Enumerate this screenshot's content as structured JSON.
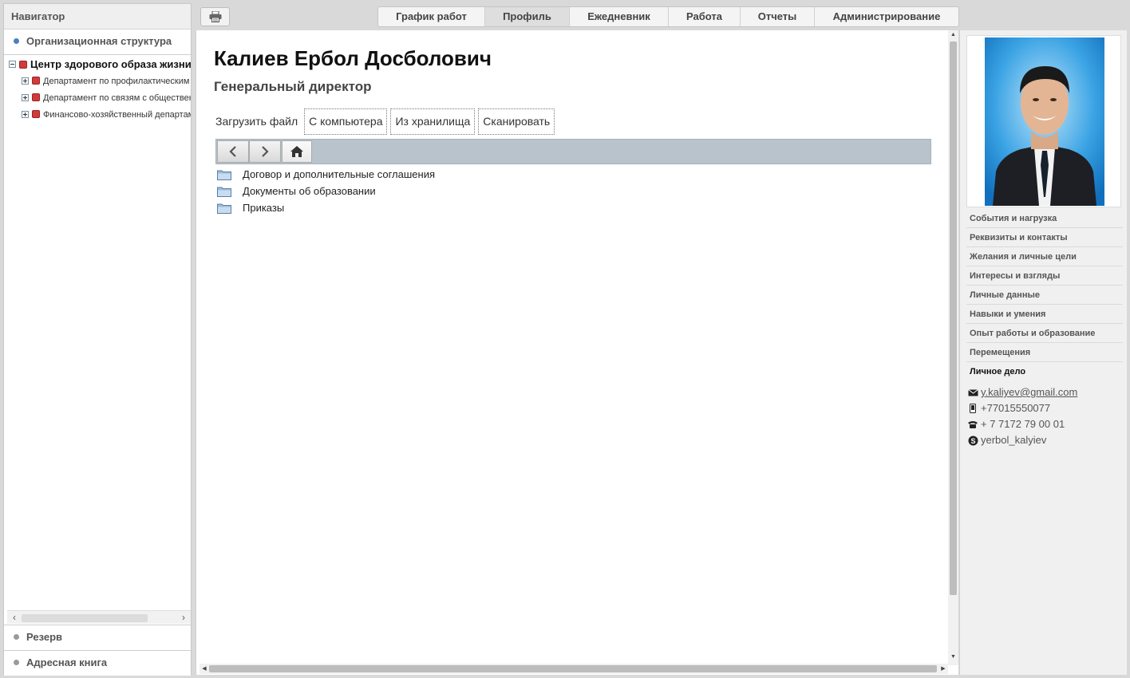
{
  "navigator": {
    "title": "Навигатор",
    "sections": {
      "org_structure": "Организационная структура",
      "reserve": "Резерв",
      "address_book": "Адресная книга"
    },
    "tree": {
      "root": "Центр здорового образа жизни",
      "children": [
        "Департамент по профилактическим программам",
        "Департамент по связям с общественностью",
        "Финансово-хозяйственный департамент"
      ]
    },
    "colors": {
      "active_dot": "#4a7fc1",
      "inactive_dot": "#9a9a9a",
      "node_marker": "#d23b3b"
    }
  },
  "toolbar": {
    "print_icon": "printer-icon",
    "tabs": [
      "График работ",
      "Профиль",
      "Ежедневник",
      "Работа",
      "Отчеты",
      "Администрирование"
    ],
    "active_tab": "Профиль"
  },
  "profile": {
    "name": "Калиев Ербол Досболович",
    "position": "Генеральный директор"
  },
  "upload": {
    "label": "Загрузить файл",
    "from_computer": "С компьютера",
    "from_storage": "Из хранилища",
    "scan": "Сканировать"
  },
  "file_browser": {
    "icons": [
      "chevron-left-icon",
      "chevron-right-icon",
      "home-icon"
    ],
    "folders": [
      "Договор и дополнительные соглашения",
      "Документы об образовании",
      "Приказы"
    ]
  },
  "side_menu": {
    "items": [
      "События и нагрузка",
      "Реквизиты и контакты",
      "Желания и личные цели",
      "Интересы и взгляды",
      "Личные данные",
      "Навыки и умения",
      "Опыт работы и образование",
      "Перемещения",
      "Личное дело"
    ],
    "active_item": "Личное дело"
  },
  "contacts": {
    "email": "y.kaliyev@gmail.com",
    "mobile": "+77015550077",
    "phone": "+ 7 7172 79 00 01",
    "skype": "yerbol_kalyiev"
  }
}
